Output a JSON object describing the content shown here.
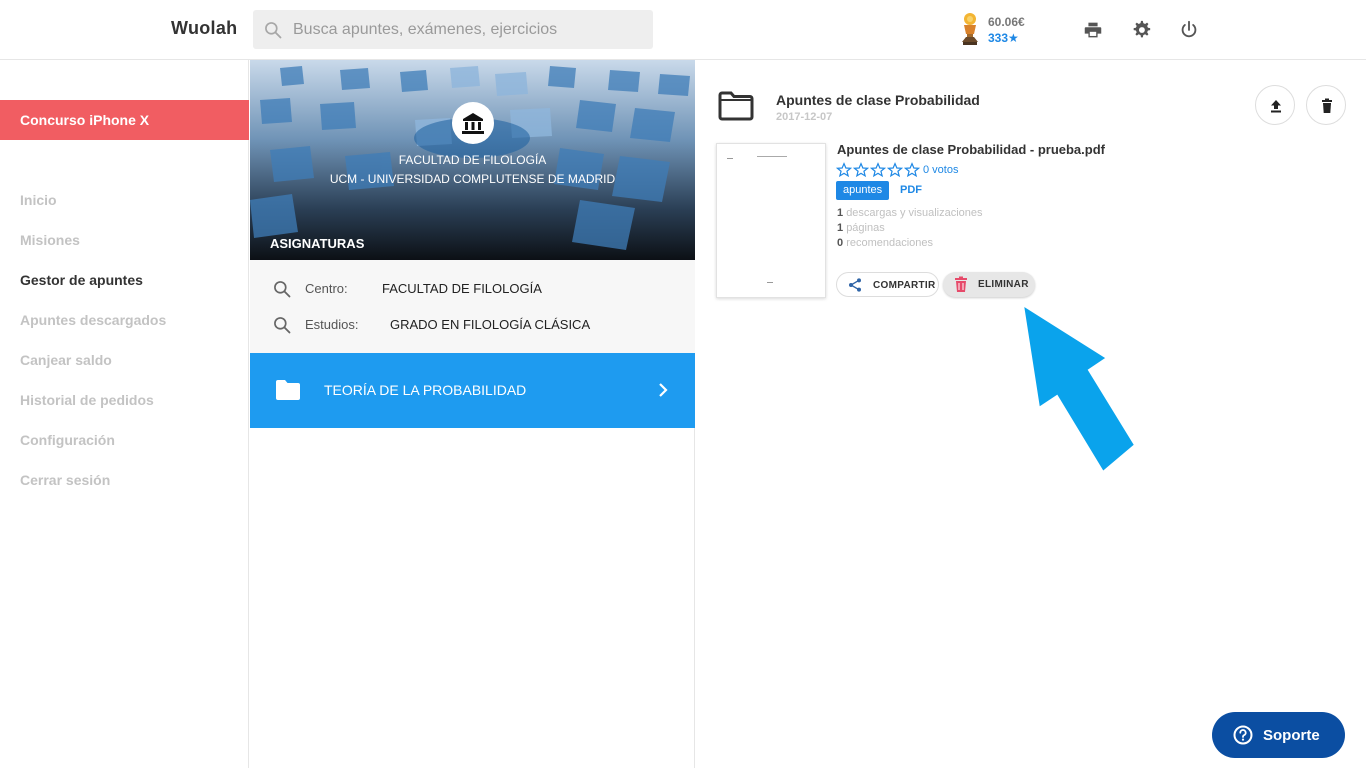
{
  "header": {
    "brand": "Wuolah",
    "search_placeholder": "Busca apuntes, exámenes, ejercicios",
    "balance": "60.06€",
    "stars": "333★"
  },
  "sidebar": {
    "promo": "Concurso iPhone X",
    "items": [
      {
        "label": "Inicio"
      },
      {
        "label": "Misiones"
      },
      {
        "label": "Gestor de apuntes"
      },
      {
        "label": "Apuntes descargados"
      },
      {
        "label": "Canjear saldo"
      },
      {
        "label": "Historial de pedidos"
      },
      {
        "label": "Configuración"
      },
      {
        "label": "Cerrar sesión"
      }
    ]
  },
  "center": {
    "faculty": "FACULTAD DE FILOLOGÍA",
    "university": "UCM - UNIVERSIDAD COMPLUTENSE DE MADRID",
    "section_title": "ASIGNATURAS",
    "filters": [
      {
        "label": "Centro:",
        "value": "FACULTAD DE FILOLOGÍA"
      },
      {
        "label": "Estudios:",
        "value": "GRADO EN FILOLOGÍA CLÁSICA"
      }
    ],
    "subject": "TEORÍA DE LA PROBABILIDAD"
  },
  "folder": {
    "title": "Apuntes de clase Probabilidad",
    "date": "2017-12-07"
  },
  "document": {
    "title": "Apuntes de clase Probabilidad - prueba.pdf",
    "rating": 0,
    "votes": "0 votos",
    "tag": "apuntes",
    "format": "PDF",
    "downloads_num": "1",
    "downloads_label": "descargas y visualizaciones",
    "pages_num": "1",
    "pages_label": "páginas",
    "recs_num": "0",
    "recs_label": "recomendaciones",
    "share_label": "COMPARTIR",
    "delete_label": "ELIMINAR"
  },
  "support": {
    "label": "Soporte"
  },
  "colors": {
    "accent": "#1e9bf0",
    "promo": "#f15d62",
    "support": "#0b4ea2",
    "arrow": "#0aa3ec"
  }
}
